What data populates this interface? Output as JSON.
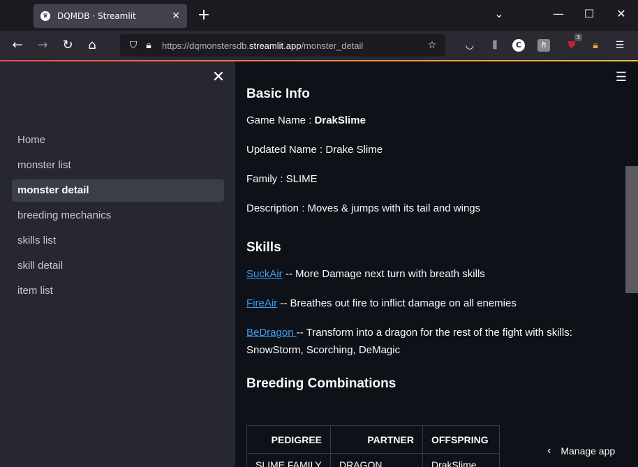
{
  "browser": {
    "tab_title": "DQMDB · Streamlit",
    "favicon_glyph": "♛",
    "url_prefix": "https://dqmonstersdb.",
    "url_domain": "streamlit.app",
    "url_path": "/monster_detail",
    "extension_badge": "3",
    "extension_c_label": "C"
  },
  "sidebar": {
    "items": [
      {
        "label": "Home"
      },
      {
        "label": "monster list"
      },
      {
        "label": "monster detail"
      },
      {
        "label": "breeding mechanics"
      },
      {
        "label": "skills list"
      },
      {
        "label": "skill detail"
      },
      {
        "label": "item list"
      }
    ],
    "active_index": 2
  },
  "main": {
    "basic_info_heading": "Basic Info",
    "game_name_label": "Game Name : ",
    "game_name_value": "DrakSlime",
    "updated_name": "Updated Name : Drake Slime",
    "family": "Family : SLIME",
    "description": "Description : Moves & jumps with its tail and wings",
    "skills_heading": "Skills",
    "skills": [
      {
        "name": "SuckAir",
        "desc": " -- More Damage next turn with breath skills"
      },
      {
        "name": "FireAir",
        "desc": " -- Breathes out fire to inflict damage on all enemies"
      },
      {
        "name": "BeDragon ",
        "desc": " -- Transform into a dragon for the rest of the fight with skills: SnowStorm, Scorching, DeMagic"
      }
    ],
    "breeding_heading": "Breeding Combinations",
    "table": {
      "headers": [
        "PEDIGREE",
        "PARTNER",
        "OFFSPRING"
      ],
      "rows": [
        [
          "SLIME FAMILY",
          "DRAGON FAMILY",
          "DrakSlime"
        ]
      ]
    }
  },
  "manage_app_label": "Manage app",
  "colors": {
    "accent": "#ff4b4b",
    "link": "#3d9df3",
    "sidebar_bg": "#262730",
    "main_bg": "#0e1117"
  }
}
